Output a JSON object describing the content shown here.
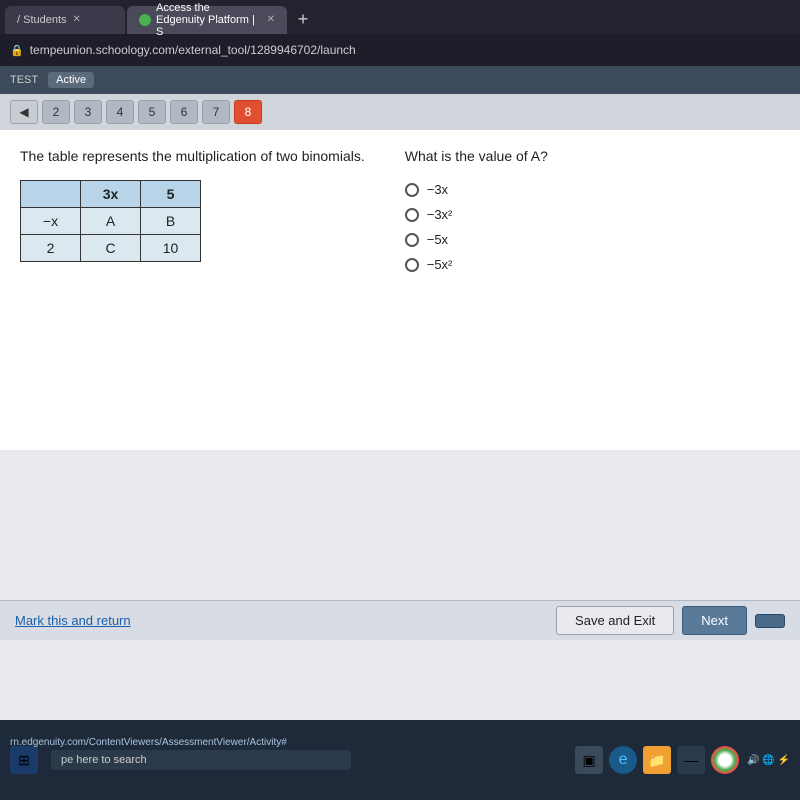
{
  "browser": {
    "tabs": [
      {
        "id": "tab1",
        "label": "/ Students",
        "active": false,
        "icon": false
      },
      {
        "id": "tab2",
        "label": "Access the Edgenuity Platform | S",
        "active": true,
        "icon": true
      }
    ],
    "url": "tempeunion.schoology.com/external_tool/1289946702/launch",
    "tab_plus": "+"
  },
  "status_bar": {
    "label": "TEST",
    "active": "Active"
  },
  "question_nav": {
    "prev": "<",
    "buttons": [
      "2",
      "3",
      "4",
      "5",
      "6",
      "7",
      "8"
    ],
    "active": "8"
  },
  "question": {
    "text": "The table represents the multiplication of two binomials.",
    "table": {
      "headers": [
        "",
        "3x",
        "5"
      ],
      "rows": [
        [
          "-x",
          "A",
          "B"
        ],
        [
          "2",
          "C",
          "10"
        ]
      ]
    },
    "side_question": "What is the value of A?",
    "choices": [
      {
        "id": "a",
        "label": "-3x"
      },
      {
        "id": "b",
        "label": "-3x²"
      },
      {
        "id": "c",
        "label": "-5x"
      },
      {
        "id": "d",
        "label": "-5x²"
      }
    ]
  },
  "actions": {
    "mark_return": "Mark this and return",
    "save_exit": "Save and Exit",
    "next": "Next"
  },
  "taskbar": {
    "url_hint": "rn.edgenuity.com/ContentViewers/AssessmentViewer/Activity#",
    "search_placeholder": "pe here to search"
  }
}
